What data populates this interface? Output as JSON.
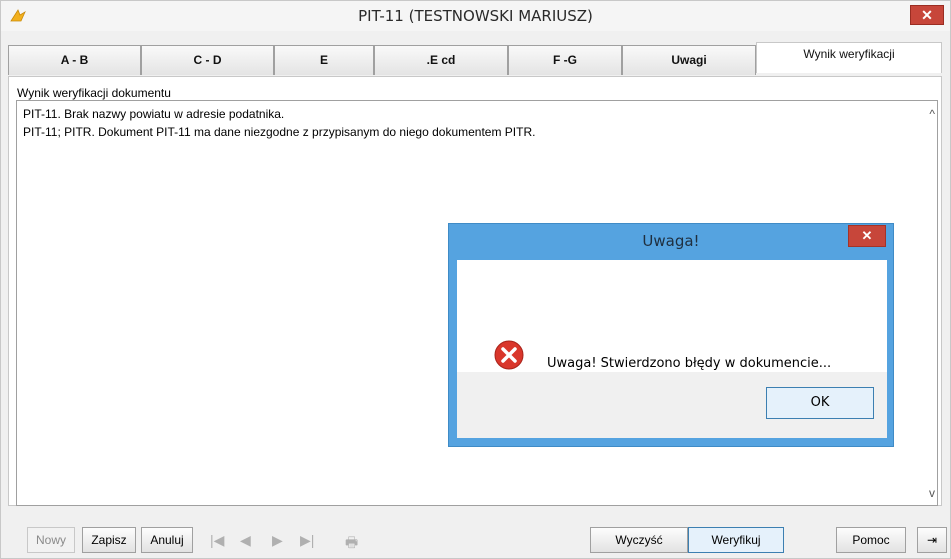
{
  "window": {
    "title": "PIT-11 (TESTNOWSKI MARIUSZ)",
    "close_label": "✕"
  },
  "tabs": [
    {
      "label": "A - B"
    },
    {
      "label": "C - D"
    },
    {
      "label": "E"
    },
    {
      "label": ".E cd"
    },
    {
      "label": "F -G"
    },
    {
      "label": "Uwagi"
    },
    {
      "label": "Wynik weryfikacji",
      "active": true
    }
  ],
  "panel": {
    "label": "Wynik weryfikacji dokumentu",
    "lines": [
      "PIT-11. Brak nazwy powiatu w adresie podatnika.",
      "PIT-11; PITR. Dokument PIT-11 ma dane niezgodne z przypisanym do niego dokumentem PITR."
    ],
    "scroll_up": "^",
    "scroll_down": "v"
  },
  "toolbar": {
    "nowy": "Nowy",
    "zapisz": "Zapisz",
    "anuluj": "Anuluj",
    "first": "|◀",
    "prev": "◀",
    "next": "▶",
    "last": "▶|",
    "print": "🖶",
    "wyczysc": "Wyczyść",
    "weryfikuj": "Weryfikuj",
    "pomoc": "Pomoc",
    "exit": "⇥"
  },
  "dialog": {
    "title": "Uwaga!",
    "close_label": "✕",
    "message": "Uwaga! Stwierdzono błędy w dokumencie...",
    "ok_label": "OK"
  },
  "colors": {
    "dialog_frame": "#55a3e0",
    "close_red": "#c7463a",
    "error_red": "#d9362b"
  }
}
